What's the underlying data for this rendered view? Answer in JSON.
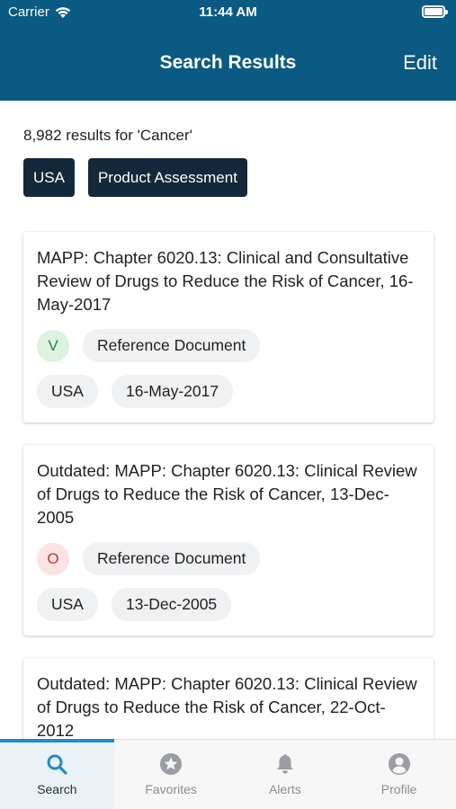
{
  "status_bar": {
    "carrier": "Carrier",
    "time": "11:44 AM"
  },
  "nav": {
    "title": "Search Results",
    "edit_label": "Edit"
  },
  "search": {
    "results_text": "8,982 results for 'Cancer'"
  },
  "filters": [
    "USA",
    "Product Assessment"
  ],
  "results": [
    {
      "title": "MAPP: Chapter 6020.13: Clinical and Consultative Review of Drugs to Reduce the Risk of Cancer, 16-May-2017",
      "status_letter": "V",
      "doc_type": "Reference Document",
      "country": "USA",
      "date": "16-May-2017"
    },
    {
      "title": "Outdated: MAPP: Chapter 6020.13: Clinical Review of Drugs to Reduce the Risk of Cancer, 13-Dec-2005",
      "status_letter": "O",
      "doc_type": "Reference Document",
      "country": "USA",
      "date": "13-Dec-2005"
    },
    {
      "title": "Outdated: MAPP: Chapter 6020.13: Clinical Review of Drugs to Reduce the Risk of Cancer, 22-Oct-2012"
    }
  ],
  "tabs": [
    {
      "label": "Search",
      "icon": "search-icon",
      "active": true
    },
    {
      "label": "Favorites",
      "icon": "star-icon",
      "active": false
    },
    {
      "label": "Alerts",
      "icon": "bell-icon",
      "active": false
    },
    {
      "label": "Profile",
      "icon": "profile-icon",
      "active": false
    }
  ],
  "colors": {
    "header_bg": "#0b5a83",
    "chip_bg": "#13283a",
    "accent": "#1d8ec9",
    "status_valid": "#2e7d43",
    "status_outdated": "#c0392b"
  }
}
